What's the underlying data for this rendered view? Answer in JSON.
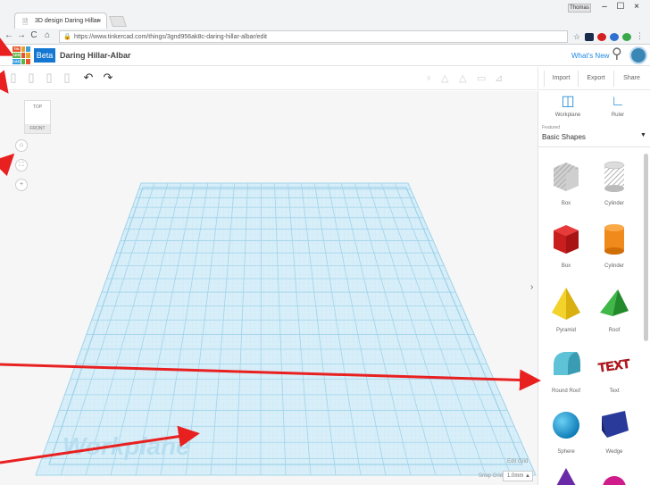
{
  "browser": {
    "tab_title": "3D design Daring Hillar-",
    "tab_close": "×",
    "user_label": "Thomas",
    "url": "https://www.tinkercad.com/things/3gnd956ak8c-daring-hillar-albar/edit",
    "window_controls": [
      "–",
      "☐",
      "×"
    ]
  },
  "app": {
    "logo_letters": [
      "TIN",
      "KER",
      "CAD"
    ],
    "beta_label": "Beta",
    "design_name": "Daring Hillar-Albar",
    "whats_new": "What's New"
  },
  "toppanel": {
    "import": "Import",
    "export": "Export",
    "share": "Share"
  },
  "workspace": {
    "viewcube_top": "TOP",
    "viewcube_front": "FRONT",
    "workplane_label": "Workplane",
    "edit_grid": "Edit Grid",
    "snap_grid_label": "Snap Grid",
    "snap_grid_value": "1.0mm ▲"
  },
  "panel": {
    "workplane_tool": "Workplane",
    "ruler_tool": "Ruler",
    "featured": "Featured",
    "category": "Basic Shapes",
    "shapes": [
      {
        "label": "Box"
      },
      {
        "label": "Cylinder"
      },
      {
        "label": "Box"
      },
      {
        "label": "Cylinder"
      },
      {
        "label": "Pyramid"
      },
      {
        "label": "Roof"
      },
      {
        "label": "Round Roof"
      },
      {
        "label": "Text"
      },
      {
        "label": "Sphere"
      },
      {
        "label": "Wedge"
      }
    ],
    "text_shape_glyph": "TEXT"
  },
  "colors": {
    "grid_line": "#a8d8ee",
    "grid_fill": "#d4eef8",
    "annotation_arrow": "#e82020",
    "accent": "#1477d1"
  }
}
